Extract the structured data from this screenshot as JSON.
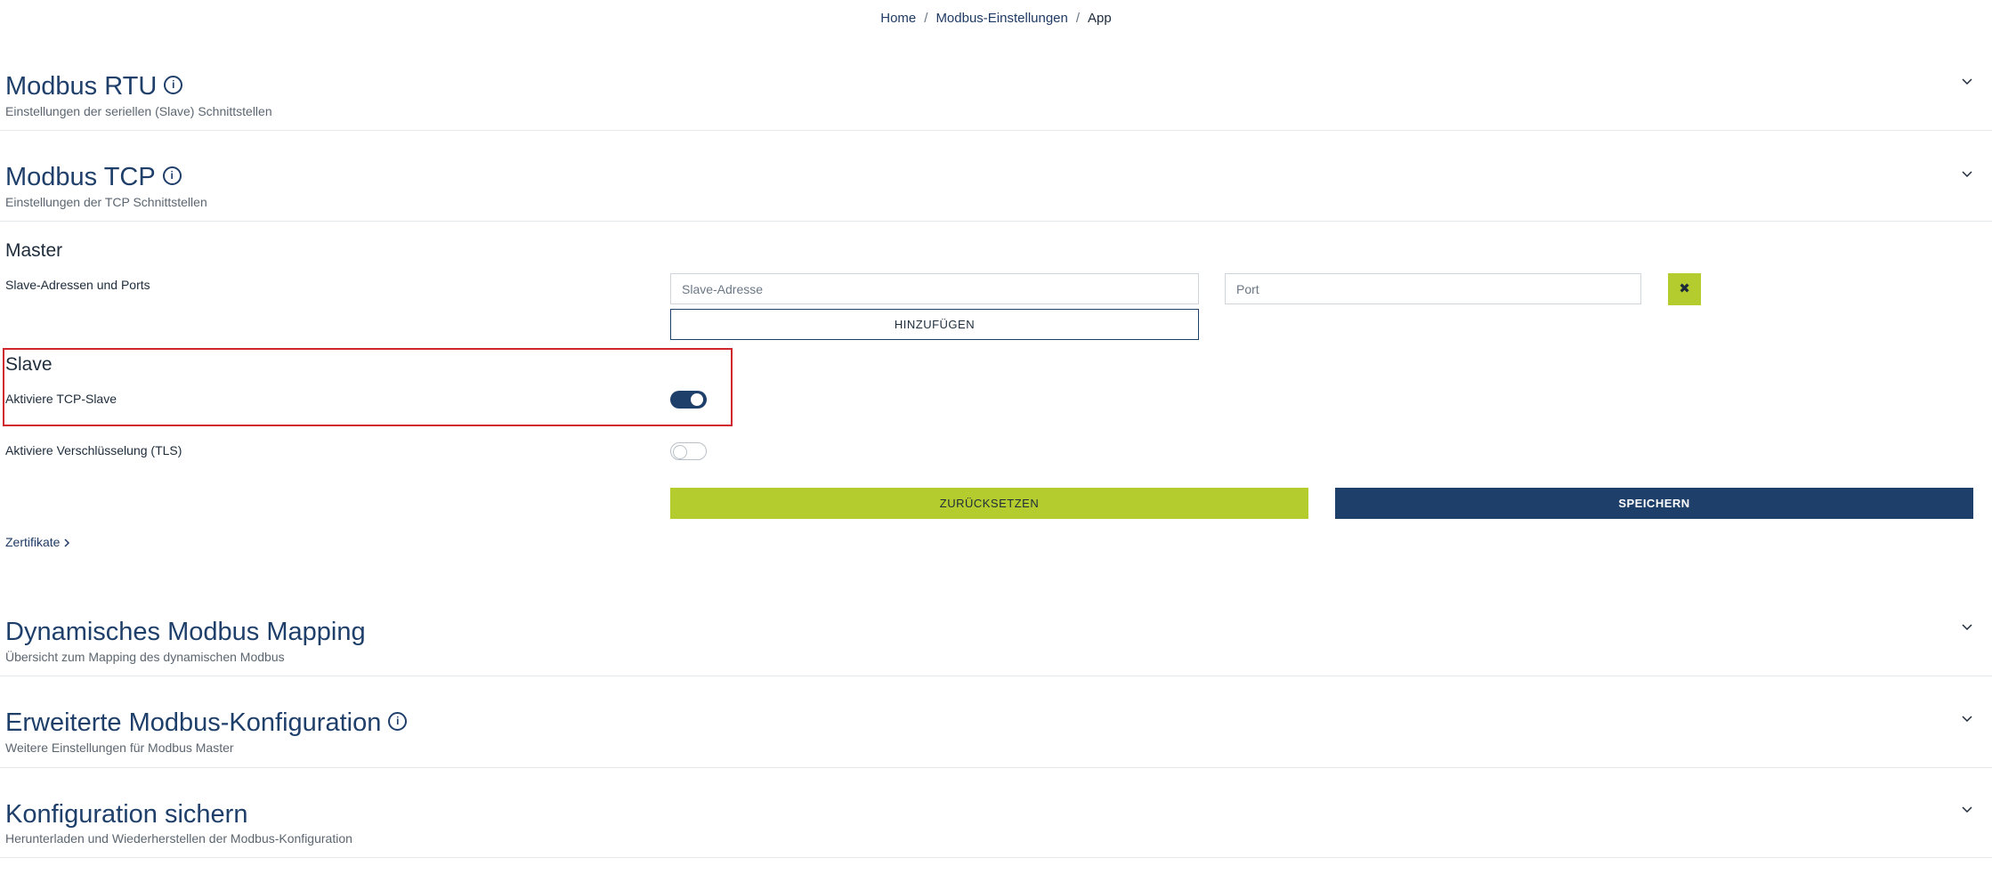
{
  "breadcrumb": {
    "home": "Home",
    "settings": "Modbus-Einstellungen",
    "current": "App"
  },
  "sections": {
    "rtu": {
      "title": "Modbus RTU",
      "subtitle": "Einstellungen der seriellen (Slave) Schnittstellen"
    },
    "tcp": {
      "title": "Modbus TCP",
      "subtitle": "Einstellungen der TCP Schnittstellen"
    },
    "mapping": {
      "title": "Dynamisches Modbus Mapping",
      "subtitle": "Übersicht zum Mapping des dynamischen Modbus"
    },
    "advanced": {
      "title": "Erweiterte Modbus-Konfiguration",
      "subtitle": "Weitere Einstellungen für Modbus Master"
    },
    "backup": {
      "title": "Konfiguration sichern",
      "subtitle": "Herunterladen und Wiederherstellen der Modbus-Konfiguration"
    }
  },
  "tcp": {
    "master": {
      "heading": "Master",
      "addresses_label": "Slave-Adressen und Ports",
      "address_placeholder": "Slave-Adresse",
      "port_placeholder": "Port",
      "add_button": "HINZUFÜGEN",
      "remove_button": "✖"
    },
    "slave": {
      "heading": "Slave",
      "tcp_slave_label": "Aktiviere TCP-Slave",
      "tcp_slave_enabled": true,
      "tls_label": "Aktiviere Verschlüsselung (TLS)",
      "tls_enabled": false
    },
    "reset_button": "ZURÜCKSETZEN",
    "save_button": "SPEICHERN",
    "certificates_link": "Zertifikate"
  },
  "colors": {
    "primary": "#1f3f6b",
    "accent": "#b5cc2e",
    "highlight": "#d0262e"
  },
  "icons": {
    "info": "info-icon",
    "expand": "chevron-down-icon",
    "link": "chevron-right-icon"
  }
}
